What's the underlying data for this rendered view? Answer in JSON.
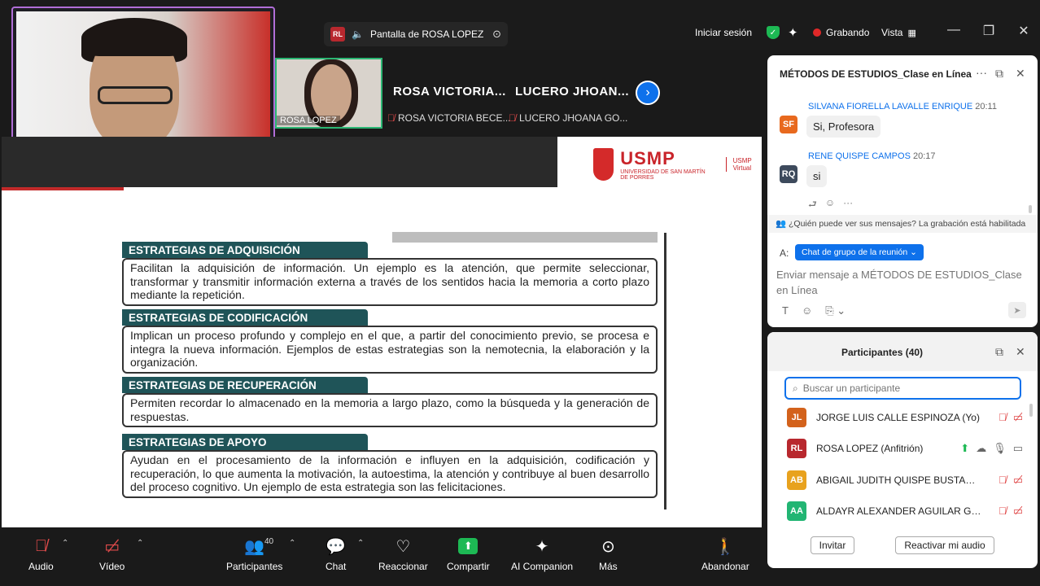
{
  "top": {
    "share_label": "Pantalla de ROSA LOPEZ",
    "share_initials": "RL",
    "signin": "Iniciar sesión",
    "recording": "Grabando",
    "view": "Vista"
  },
  "videos": {
    "tile1_label": "ROSA LOPEZ",
    "tile2_name": "ROSA  VICTORIA...",
    "tile2_sub": "ROSA VICTORIA BECE...",
    "tile3_name": "LUCERO  JHOAN...",
    "tile3_sub": "LUCERO JHOANA GO..."
  },
  "slide": {
    "logo": "USMP",
    "logo_sub": "UNIVERSIDAD DE SAN MARTÍN DE PORRES",
    "logo_virtual": "USMP Virtual",
    "strategies": [
      {
        "title": "ESTRATEGIAS DE ADQUISICIÓN",
        "body": "Facilitan la adquisición de información. Un ejemplo es la atención, que permite seleccionar, transformar y transmitir información externa a través de los sentidos hacia la memoria a corto plazo mediante la repetición."
      },
      {
        "title": "ESTRATEGIAS DE CODIFICACIÓN",
        "body": "Implican un proceso profundo y complejo en el que, a partir del conocimiento previo, se procesa e integra la nueva información. Ejemplos de estas estrategias son la nemotecnia, la elaboración y la organización."
      },
      {
        "title": "ESTRATEGIAS DE RECUPERACIÓN",
        "body": "Permiten recordar lo almacenado en la memoria a largo plazo, como la búsqueda y la generación de respuestas."
      },
      {
        "title": "ESTRATEGIAS DE APOYO",
        "body": "Ayudan en el procesamiento de la información e influyen en la adquisición, codificación y recuperación, lo que aumenta la motivación, la autoestima, la atención y contribuye al buen desarrollo del proceso cognitivo. Un ejemplo de esta estrategia son las felicitaciones."
      }
    ]
  },
  "chat": {
    "title": "MÉTODOS DE ESTUDIOS_Clase en Línea",
    "messages": [
      {
        "initials": "SF",
        "sender": "SILVANA FIORELLA LAVALLE ENRIQUE",
        "time": "20:11",
        "text": "Si, Profesora",
        "color": "#e8691e"
      },
      {
        "initials": "RQ",
        "sender": "RENE QUISPE CAMPOS",
        "time": "20:17",
        "text": "si",
        "color": "#3d4a5c"
      }
    ],
    "notice": "¿Quién puede ver sus mensajes? La grabación está habilitada",
    "to_label": "A:",
    "to_value": "Chat de grupo de la reunión",
    "placeholder": "Enviar mensaje a MÉTODOS DE ESTUDIOS_Clase en Línea"
  },
  "participants": {
    "title": "Participantes (40)",
    "search_placeholder": "Buscar un participante",
    "rows": [
      {
        "initials": "JL",
        "name": "JORGE LUIS CALLE ESPINOZA (Yo)",
        "color": "#d3621c"
      },
      {
        "initials": "RL",
        "name": "ROSA LOPEZ (Anfitrión)",
        "color": "#b8282e"
      },
      {
        "initials": "AB",
        "name": "ABIGAIL JUDITH QUISPE BUSTAMAN...",
        "color": "#e8a21e"
      },
      {
        "initials": "AA",
        "name": "ALDAYR ALEXANDER AGUILAR GUITI...",
        "color": "#22b573"
      }
    ],
    "invite": "Invitar",
    "reactivate_audio": "Reactivar mi audio"
  },
  "toolbar": {
    "audio": "Audio",
    "video": "Vídeo",
    "participants": "Participantes",
    "participants_count": "40",
    "chat": "Chat",
    "react": "Reaccionar",
    "share": "Compartir",
    "ai": "AI Companion",
    "more": "Más",
    "leave": "Abandonar"
  }
}
